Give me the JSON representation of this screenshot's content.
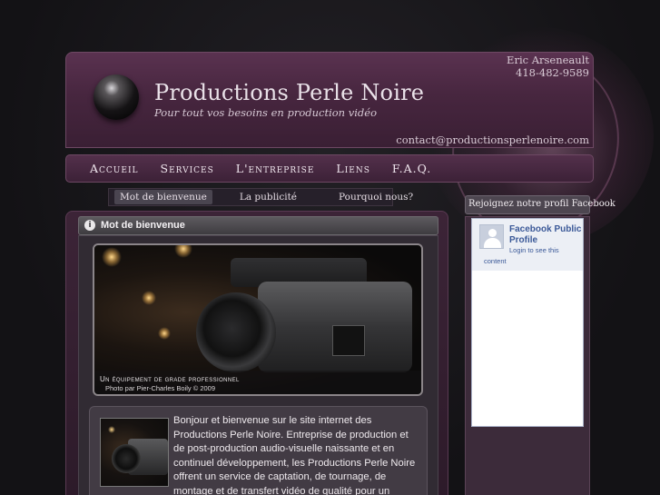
{
  "header": {
    "site_title": "Productions Perle Noire",
    "tagline": "Pour tout vos besoins en production vidéo",
    "contact_name": "Eric Arseneault",
    "contact_phone": "418-482-9589",
    "contact_email": "contact@productionsperlenoire.com"
  },
  "nav": {
    "items": [
      "Accueil",
      "Services",
      "L'entreprise",
      "Liens",
      "F.A.Q."
    ]
  },
  "subtabs": {
    "items": [
      "Mot de bienvenue",
      "La publicité",
      "Pourquoi nous?"
    ],
    "active": "Mot de bienvenue"
  },
  "main": {
    "panel_title": "Mot de bienvenue",
    "hero_caption": "Un équipement de grade professionnel",
    "hero_credit": "Photo par Pier-Charles Boily © 2009",
    "intro_text": "Bonjour et bienvenue sur le site internet des Productions Perle Noire. Entreprise de production et de post-production audio-visuelle naissante et en continuel développement, les Productions Perle Noire offrent un service de captation, de tournage, de montage et de transfert vidéo de qualité pour un"
  },
  "sidebar": {
    "facebook_title": "Rejoignez notre profil Facebook",
    "fb_name": "Facebook Public Profile",
    "fb_login": "Login to see this",
    "fb_content": "content"
  },
  "colors": {
    "background": "#141316",
    "header": "#47263f",
    "facebook_blue": "#3b5998"
  },
  "icons": {
    "info": "info-icon",
    "logo": "black-pearl-icon",
    "avatar": "default-profile-icon"
  }
}
